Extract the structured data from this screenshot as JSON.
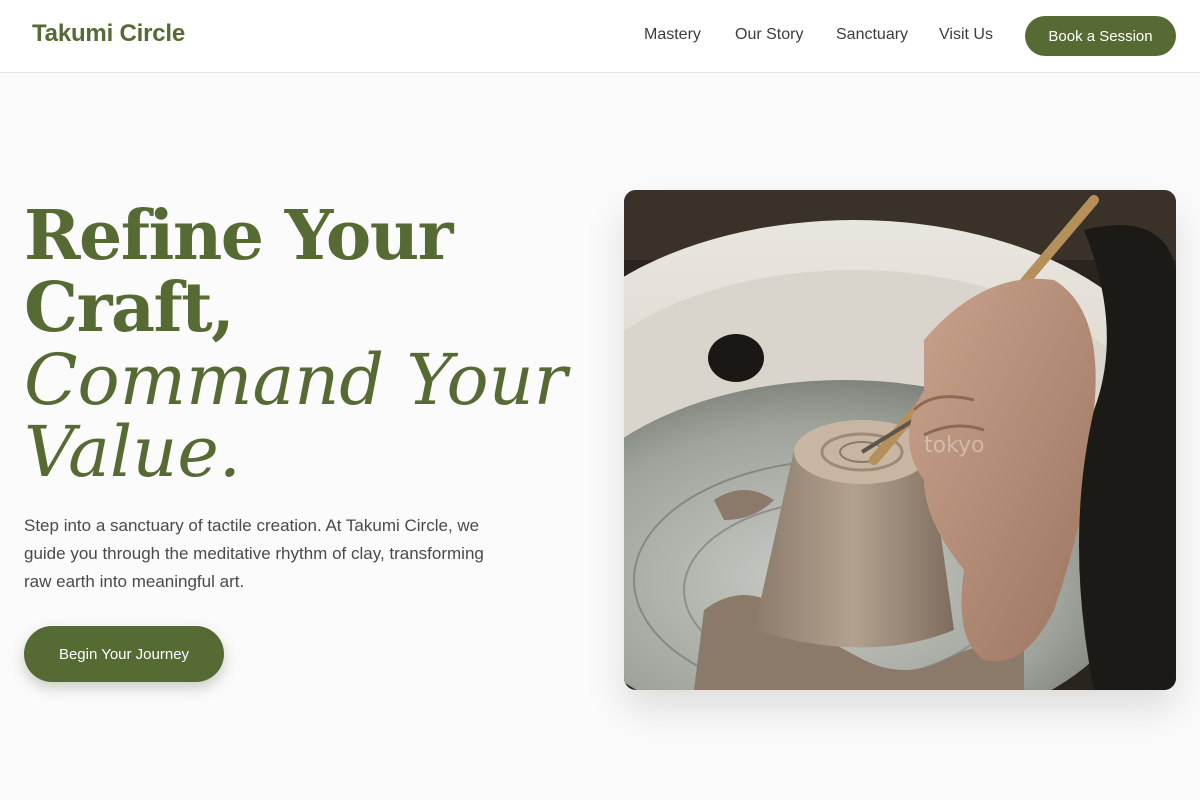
{
  "nav": {
    "brand": "Takumi Circle",
    "links": [
      "Mastery",
      "Our Story",
      "Sanctuary",
      "Visit Us"
    ],
    "cta": "Book a Session"
  },
  "hero": {
    "headline_bold_1": "Refine Your",
    "headline_bold_2": "Craft,",
    "headline_italic_1": "Command Your",
    "headline_italic_2": "Value.",
    "intro": "Step into a sanctuary of tactile creation. At Takumi Circle, we guide you through the meditative rhythm of clay, transforming raw earth into meaningful art.",
    "cta": "Begin Your Journey",
    "image": {
      "subject": "hands trimming clay pot on pottery wheel",
      "watermark": "tokyo"
    }
  },
  "colors": {
    "accent": "#566a34",
    "background": "#fbfbfb",
    "text": "#4a4a4a"
  }
}
